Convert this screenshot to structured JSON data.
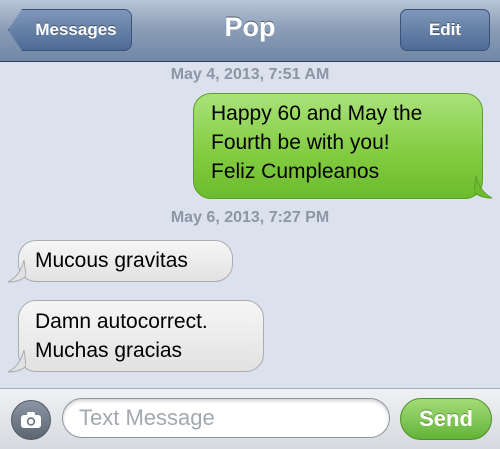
{
  "nav": {
    "back_label": "Messages",
    "title": "Pop",
    "edit_label": "Edit"
  },
  "conversation": {
    "timestamps": [
      "May 4, 2013, 7:51 AM",
      "May 6, 2013, 7:27 PM"
    ],
    "messages": [
      {
        "direction": "sent",
        "lines": [
          "Happy 60 and May the",
          "Fourth be with you!",
          "Feliz Cumpleanos"
        ]
      },
      {
        "direction": "received",
        "lines": [
          "Mucous gravitas"
        ]
      },
      {
        "direction": "received",
        "lines": [
          "Damn autocorrect.",
          "Muchas gracias"
        ]
      }
    ]
  },
  "composer": {
    "camera_icon": "camera-icon",
    "placeholder": "Text Message",
    "value": "",
    "send_label": "Send"
  },
  "colors": {
    "sent_bubble": "#84cd43",
    "received_bubble": "#e8e8e8",
    "background": "#dbe2ed",
    "nav_bar": "#8d9fb8"
  }
}
